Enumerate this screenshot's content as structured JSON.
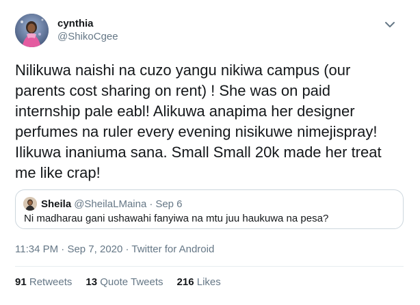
{
  "author": {
    "display_name": "cynthia",
    "handle": "@ShikoCgee"
  },
  "tweet": {
    "text": "Nilikuwa naishi na cuzo yangu nikiwa campus (our\nparents cost sharing on rent) ! She was on paid\ninternship pale eabl! Alikuwa anapima her designer\nperfumes na ruler every evening nisikuwe nimejispray!\nIlikuwa inaniuma sana. Small Small 20k made her treat\nme like crap!"
  },
  "quoted_tweet": {
    "display_name": "Sheila",
    "handle": "@SheilaLMaina",
    "separator": "·",
    "date": "Sep 6",
    "text": "Ni madharau gani ushawahi fanyiwa na mtu juu haukuwa na pesa?"
  },
  "meta": {
    "time": "11:34 PM",
    "sep1": " · ",
    "date": "Sep 7, 2020",
    "sep2": " · ",
    "source": "Twitter for Android"
  },
  "stats": {
    "retweets_count": "91",
    "retweets_label": "Retweets",
    "quote_count": "13",
    "quote_label": "Quote Tweets",
    "likes_count": "216",
    "likes_label": "Likes"
  },
  "colors": {
    "text": "#14171a",
    "secondary": "#657786",
    "border": "#ccd6dd"
  },
  "icons": {
    "caret": "chevron-down-icon"
  }
}
